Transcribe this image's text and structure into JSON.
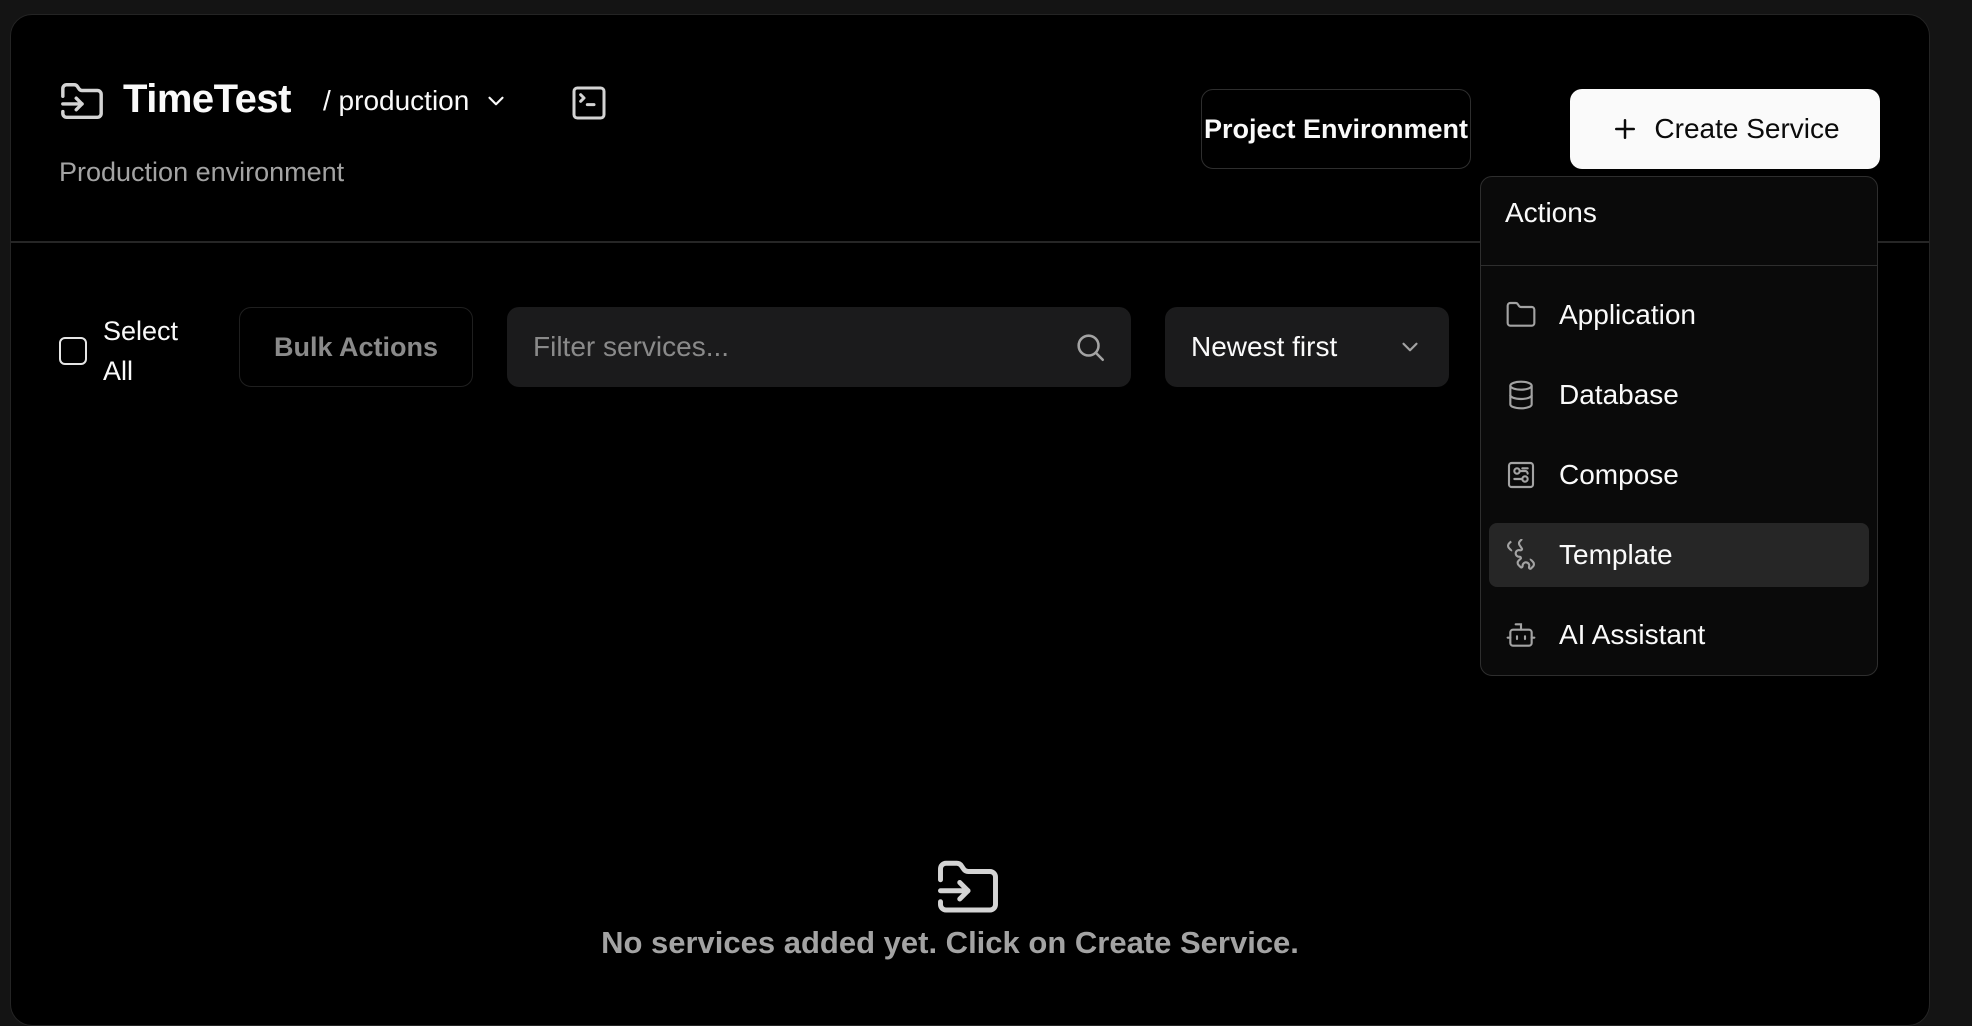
{
  "project": {
    "name": "TimeTest",
    "environment": "/ production",
    "description": "Production environment"
  },
  "header": {
    "project_env_label": "Project Environment",
    "create_service_label": "Create Service"
  },
  "toolbar": {
    "select_all_label": "Select All",
    "bulk_actions_label": "Bulk Actions",
    "filter_placeholder": "Filter services...",
    "sort_value": "Newest first"
  },
  "empty_state": {
    "message": "No services added yet. Click on Create Service."
  },
  "actions_menu": {
    "label": "Actions",
    "items": [
      {
        "label": "Application",
        "icon": "folder-icon"
      },
      {
        "label": "Database",
        "icon": "database-icon"
      },
      {
        "label": "Compose",
        "icon": "compose-icon"
      },
      {
        "label": "Template",
        "icon": "puzzle-icon",
        "highlighted": true
      },
      {
        "label": "AI Assistant",
        "icon": "bot-icon"
      }
    ]
  }
}
